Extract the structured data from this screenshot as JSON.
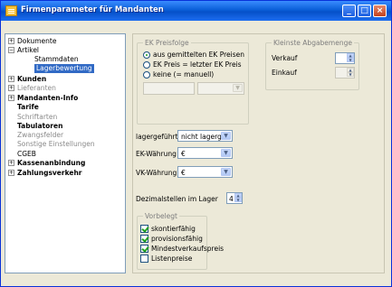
{
  "window": {
    "title": "Firmenparameter für Mandanten",
    "minimize_glyph": "_",
    "maximize_glyph": "□",
    "close_glyph": "×"
  },
  "tree": {
    "items": [
      {
        "label": "Dokumente",
        "expander": "+",
        "bold": false,
        "gray": false
      },
      {
        "label": "Artikel",
        "expander": "−",
        "bold": false,
        "gray": false
      },
      {
        "label": "Stammdaten",
        "expander": "",
        "bold": false,
        "gray": false
      },
      {
        "label": "Lagerbewertung",
        "expander": "",
        "bold": false,
        "gray": false,
        "selected": true
      },
      {
        "label": "Kunden",
        "expander": "+",
        "bold": true,
        "gray": false
      },
      {
        "label": "Lieferanten",
        "expander": "+",
        "bold": false,
        "gray": true
      },
      {
        "label": "Mandanten-Info",
        "expander": "+",
        "bold": true,
        "gray": false
      },
      {
        "label": "Tarife",
        "expander": "",
        "bold": true,
        "gray": false
      },
      {
        "label": "Schriftarten",
        "expander": "",
        "bold": false,
        "gray": true
      },
      {
        "label": "Tabulatoren",
        "expander": "",
        "bold": true,
        "gray": false
      },
      {
        "label": "Zwangsfelder",
        "expander": "",
        "bold": false,
        "gray": true
      },
      {
        "label": "Sonstige Einstellungen",
        "expander": "",
        "bold": false,
        "gray": true
      },
      {
        "label": "CGEB",
        "expander": "",
        "bold": false,
        "gray": false
      },
      {
        "label": "Kassenanbindung",
        "expander": "+",
        "bold": true,
        "gray": false
      },
      {
        "label": "Zahlungsverkehr",
        "expander": "+",
        "bold": true,
        "gray": false
      }
    ]
  },
  "ek_preisfolge": {
    "title": "EK Preisfolge",
    "options": [
      {
        "label": "aus gemittelten EK Preisen",
        "checked": true
      },
      {
        "label": "EK Preis = letzter EK Preis",
        "checked": false
      },
      {
        "label": "keine (= manuell)",
        "checked": false
      }
    ]
  },
  "kleinste_abgabemenge": {
    "title": "Kleinste Abgabemenge",
    "verkauf_label": "Verkauf",
    "einkauf_label": "Einkauf",
    "verkauf_value": "",
    "einkauf_value": ""
  },
  "settings": {
    "lagergefuehrt_label": "lagergeführt",
    "lagergefuehrt_value": "nicht lagergef",
    "ek_waehrung_label": "EK-Währung",
    "ek_waehrung_value": "€",
    "vk_waehrung_label": "VK-Währung",
    "vk_waehrung_value": "€",
    "dezimalstellen_label": "Dezimalstellen im Lager",
    "dezimalstellen_value": "4"
  },
  "vorbelegt": {
    "title": "Vorbelegt",
    "items": [
      {
        "label": "skontierfähig",
        "checked": true
      },
      {
        "label": "provisionsfähig",
        "checked": true
      },
      {
        "label": "Mindestverkaufspreis",
        "checked": true
      },
      {
        "label": "Listenpreise",
        "checked": false
      }
    ]
  },
  "icons": {
    "dropdown_arrow": "▼",
    "spin_up": "▲",
    "spin_down": "▼"
  },
  "colors": {
    "titlebar": "#0a5fd8",
    "selection": "#316ac5",
    "check": "#21a121"
  }
}
